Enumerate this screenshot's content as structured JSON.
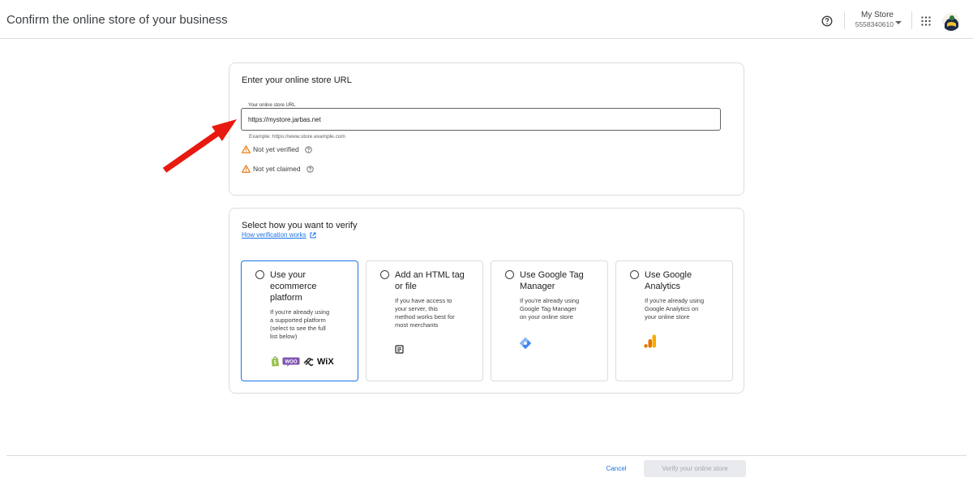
{
  "header": {
    "title": "Confirm the online store of your business",
    "account_name": "My Store",
    "account_id": "5558340610"
  },
  "url_card": {
    "title": "Enter your online store URL",
    "field_label": "Your online store URL",
    "field_value": "https://mystore.jarbas.net",
    "helper": "Example: https://www.store.example.com",
    "status_verified": "Not yet verified",
    "status_claimed": "Not yet claimed"
  },
  "verify_card": {
    "title": "Select how you want to verify",
    "link": "How verification works",
    "options": [
      {
        "title_lines": [
          "Use your",
          "ecommerce",
          "platform"
        ],
        "desc_lines": [
          "If you're already using",
          "a supported platform",
          "(select to see the full",
          "list below)"
        ],
        "platforms": [
          "shopify-icon",
          "woo-icon",
          "squarespace-icon",
          "wix-icon"
        ],
        "wix_label": "WiX",
        "woo_label": "WOO"
      },
      {
        "title_lines": [
          "Add an HTML tag",
          "or file"
        ],
        "desc_lines": [
          "If you have access to",
          "your server, this",
          "method works best for",
          "most merchants"
        ],
        "icon": "document-icon"
      },
      {
        "title_lines": [
          "Use Google Tag",
          "Manager"
        ],
        "desc_lines": [
          "If you're already using",
          "Google Tag Manager",
          "on your online store"
        ],
        "icon": "tag-manager-icon"
      },
      {
        "title_lines": [
          "Use Google",
          "Analytics"
        ],
        "desc_lines": [
          "If you're already using",
          "Google Analytics on",
          "your online store"
        ],
        "icon": "analytics-icon"
      }
    ]
  },
  "footer": {
    "cancel": "Cancel",
    "verify": "Verify your online store"
  },
  "colors": {
    "accent": "#1a73e8",
    "warning": "#e37400",
    "arrow": "#e8190f"
  }
}
